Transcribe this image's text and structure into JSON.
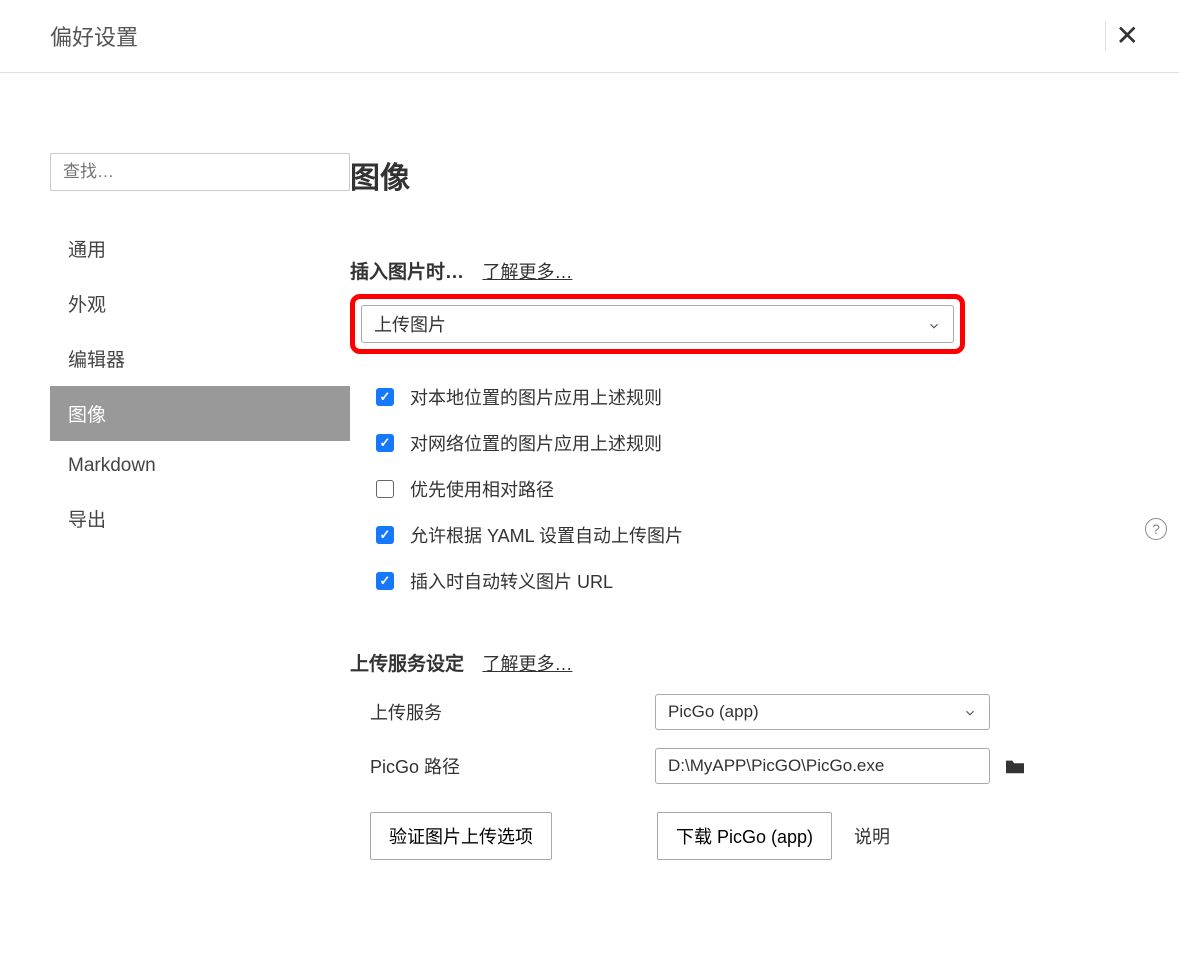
{
  "header": {
    "title": "偏好设置"
  },
  "sidebar": {
    "search_placeholder": "查找…",
    "items": [
      {
        "label": "通用",
        "active": false
      },
      {
        "label": "外观",
        "active": false
      },
      {
        "label": "编辑器",
        "active": false
      },
      {
        "label": "图像",
        "active": true
      },
      {
        "label": "Markdown",
        "active": false
      },
      {
        "label": "导出",
        "active": false
      }
    ]
  },
  "main": {
    "page_title": "图像",
    "insert_section": {
      "label": "插入图片时…",
      "learn_more": "了解更多…",
      "dropdown_value": "上传图片",
      "checkboxes": [
        {
          "label": "对本地位置的图片应用上述规则",
          "checked": true
        },
        {
          "label": "对网络位置的图片应用上述规则",
          "checked": true
        },
        {
          "label": "优先使用相对路径",
          "checked": false
        },
        {
          "label": "允许根据 YAML 设置自动上传图片",
          "checked": true
        },
        {
          "label": "插入时自动转义图片 URL",
          "checked": true
        }
      ]
    },
    "upload_section": {
      "label": "上传服务设定",
      "learn_more": "了解更多…",
      "service_label": "上传服务",
      "service_value": "PicGo (app)",
      "path_label": "PicGo 路径",
      "path_value": "D:\\MyAPP\\PicGO\\PicGo.exe",
      "verify_button": "验证图片上传选项",
      "download_button": "下载 PicGo (app)",
      "info_link": "说明"
    }
  }
}
